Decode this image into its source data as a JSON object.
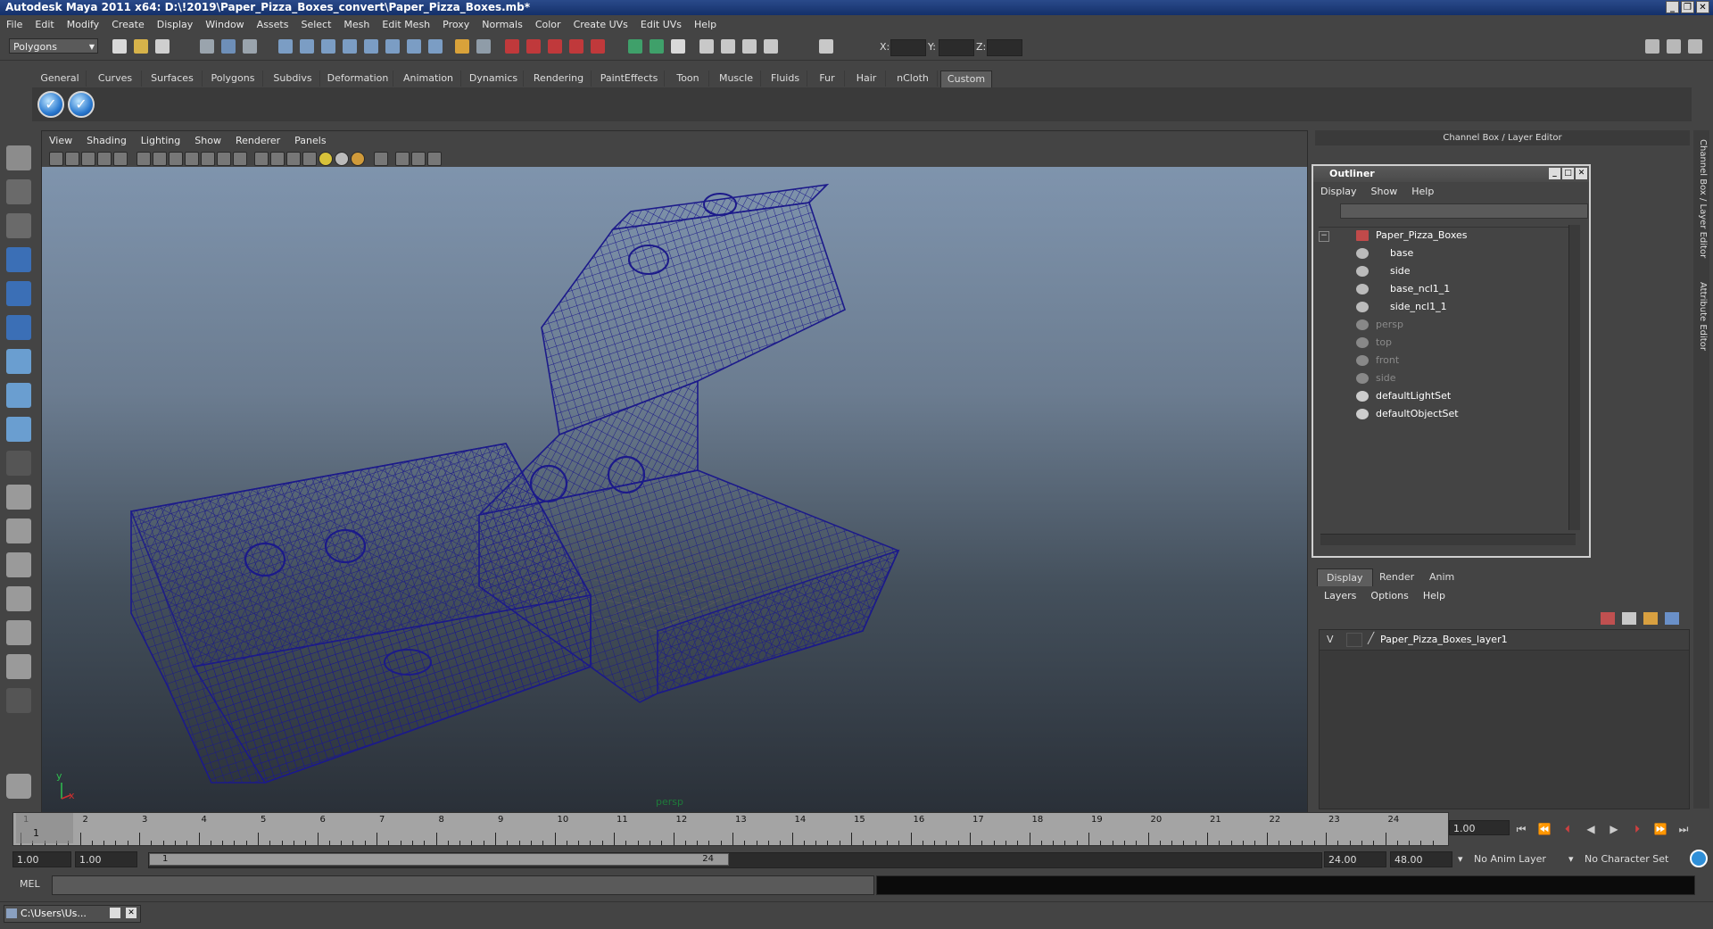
{
  "window": {
    "title": "Autodesk Maya 2011 x64: D:\\!2019\\Paper_Pizza_Boxes_convert\\Paper_Pizza_Boxes.mb*",
    "buttons": [
      "_",
      "❐",
      "✕"
    ]
  },
  "menubar": [
    "File",
    "Edit",
    "Modify",
    "Create",
    "Display",
    "Window",
    "Assets",
    "Select",
    "Mesh",
    "Edit Mesh",
    "Proxy",
    "Normals",
    "Color",
    "Create UVs",
    "Edit UVs",
    "Help"
  ],
  "statusline": {
    "mode": "Polygons",
    "x_label": "X:",
    "y_label": "Y:",
    "z_label": "Z:"
  },
  "shelf": {
    "tabs": [
      "General",
      "Curves",
      "Surfaces",
      "Polygons",
      "Subdivs",
      "Deformation",
      "Animation",
      "Dynamics",
      "Rendering",
      "PaintEffects",
      "Toon",
      "Muscle",
      "Fluids",
      "Fur",
      "Hair",
      "nCloth",
      "Custom"
    ],
    "active_tab": "Custom"
  },
  "viewport": {
    "menu": [
      "View",
      "Shading",
      "Lighting",
      "Show",
      "Renderer",
      "Panels"
    ],
    "camera": "persp",
    "axis_y": "y",
    "axis_x": "x",
    "wire_color": "#1c1a8a"
  },
  "channel_box": {
    "header": "Channel Box / Layer Editor"
  },
  "outliner": {
    "title": "Outliner",
    "menu": [
      "Display",
      "Show",
      "Help"
    ],
    "items": [
      {
        "label": "Paper_Pizza_Boxes",
        "depth": 0,
        "dim": false
      },
      {
        "label": "base",
        "depth": 1,
        "dim": false
      },
      {
        "label": "side",
        "depth": 1,
        "dim": false
      },
      {
        "label": "base_ncl1_1",
        "depth": 1,
        "dim": false
      },
      {
        "label": "side_ncl1_1",
        "depth": 1,
        "dim": false
      },
      {
        "label": "persp",
        "depth": 0,
        "dim": true
      },
      {
        "label": "top",
        "depth": 0,
        "dim": true
      },
      {
        "label": "front",
        "depth": 0,
        "dim": true
      },
      {
        "label": "side",
        "depth": 0,
        "dim": true
      },
      {
        "label": "defaultLightSet",
        "depth": 0,
        "dim": false
      },
      {
        "label": "defaultObjectSet",
        "depth": 0,
        "dim": false
      }
    ]
  },
  "layer_editor": {
    "tabs": [
      "Display",
      "Render",
      "Anim"
    ],
    "active_tab": "Display",
    "menu": [
      "Layers",
      "Options",
      "Help"
    ],
    "layers": [
      {
        "visible": "V",
        "name": "Paper_Pizza_Boxes_layer1"
      }
    ]
  },
  "side_tabs": [
    "Channel Box / Layer Editor",
    "Attribute Editor"
  ],
  "timeslider": {
    "ticks": [
      "1",
      "2",
      "3",
      "4",
      "5",
      "6",
      "7",
      "8",
      "9",
      "10",
      "11",
      "12",
      "13",
      "14",
      "15",
      "16",
      "17",
      "18",
      "19",
      "20",
      "21",
      "22",
      "23",
      "24"
    ],
    "current_frame_marker": "1",
    "current_frame": "1.00"
  },
  "range": {
    "start": "1.00",
    "playback_start": "1.00",
    "handle_start": "1",
    "handle_end": "24",
    "playback_end": "24.00",
    "end": "48.00",
    "anim_layer": "No Anim Layer",
    "character_set": "No Character Set"
  },
  "command_line": {
    "label": "MEL"
  },
  "taskbar": {
    "minimized_window": "C:\\Users\\Us..."
  }
}
